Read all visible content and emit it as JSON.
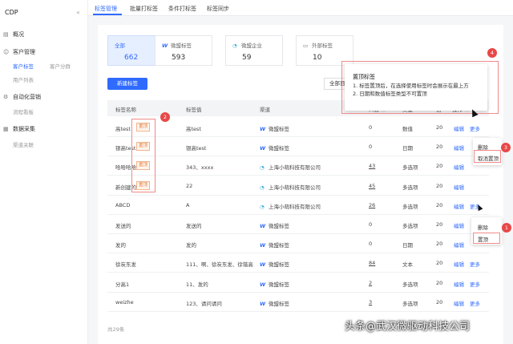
{
  "app": {
    "name": "CDP",
    "collapse_icon": "«"
  },
  "sidebar": {
    "overview": "概况",
    "customer_mgmt": "客户管理",
    "customer_tags": "客户标签",
    "customer_segment": "客户分群",
    "user_list": "用户列表",
    "automation": "自动化营销",
    "flow_board": "流程看板",
    "data_collect": "数据采集",
    "channel_link": "渠道关联"
  },
  "tabs": [
    "标签管理",
    "批量打标签",
    "条件打标签",
    "标签同步"
  ],
  "cards": [
    {
      "title": "全部",
      "value": "662"
    },
    {
      "title": "微盟标签",
      "value": "593"
    },
    {
      "title": "微盟企业",
      "value": "59"
    },
    {
      "title": "外部标签",
      "value": "10"
    }
  ],
  "buttons": {
    "new_tag": "新建标签",
    "all_filter": "全部目标"
  },
  "table": {
    "headers": [
      "标签名称",
      "标签值",
      "渠道",
      "人数",
      "类型",
      "创",
      "操作"
    ],
    "rows": [
      {
        "name": "高test",
        "pinned": true,
        "value": "高test",
        "channel": "微盟标签",
        "ch": "w",
        "count": "0",
        "count_u": false,
        "type": "数值",
        "date": "20",
        "more": true
      },
      {
        "name": "银高test",
        "pinned": true,
        "value": "银高test",
        "channel": "微盟标签",
        "ch": "w",
        "count": "0",
        "count_u": false,
        "type": "日期",
        "date": "20",
        "more": false
      },
      {
        "name": "哈哈哈哈",
        "pinned": true,
        "value": "343、xxxx",
        "channel": "上海小萌科技有限公司",
        "ch": "q",
        "count": "43",
        "count_u": true,
        "type": "多选项",
        "date": "20",
        "more": false
      },
      {
        "name": "新创建的",
        "pinned": true,
        "value": "22",
        "channel": "上海小萌科技有限公司",
        "ch": "q",
        "count": "45",
        "count_u": true,
        "type": "多选项",
        "date": "20",
        "more": false
      },
      {
        "name": "ABCD",
        "pinned": false,
        "value": "A",
        "channel": "上海小萌科技有限公司",
        "ch": "q",
        "count": "26",
        "count_u": true,
        "type": "多选项",
        "date": "20",
        "more": true
      },
      {
        "name": "发送的",
        "pinned": false,
        "value": "发送的",
        "channel": "微盟标签",
        "ch": "w",
        "count": "0",
        "count_u": false,
        "type": "多选项",
        "date": "20",
        "more": false
      },
      {
        "name": "发的",
        "pinned": false,
        "value": "发的",
        "channel": "微盟标签",
        "ch": "w",
        "count": "0",
        "count_u": false,
        "type": "日期",
        "date": "20",
        "more": false
      },
      {
        "name": "徐炭东发",
        "pinned": false,
        "value": "111、啊、徐炭东发、徐锴高",
        "channel": "微盟标签",
        "ch": "w",
        "count": "84",
        "count_u": true,
        "type": "文本",
        "date": "20",
        "more": true
      },
      {
        "name": "分高1",
        "pinned": false,
        "value": "11、发的",
        "channel": "微盟标签",
        "ch": "w",
        "count": "2",
        "count_u": true,
        "type": "多选项",
        "date": "20",
        "more": true
      },
      {
        "name": "weizhe",
        "pinned": false,
        "value": "123、请问请问",
        "channel": "微盟标签",
        "ch": "w",
        "count": "3",
        "count_u": true,
        "type": "多选项",
        "date": "20",
        "more": true
      }
    ],
    "pin_label": "置顶",
    "edit": "编辑",
    "more": "更多",
    "total": "共29条"
  },
  "tooltip": {
    "title": "置顶标签",
    "line1": "1. 标签置顶后，在选择使用标签时会展示在最上方",
    "line2": "2. 日期和数值标签类型不可置顶"
  },
  "menu_top": {
    "item1": "删除",
    "item2": "取消置顶"
  },
  "menu_bottom": {
    "item1": "删除",
    "item2": "置顶"
  },
  "markers": [
    "1",
    "2",
    "3",
    "4"
  ],
  "watermark": "头条@武汉微驱动科技公司",
  "colors": {
    "primary": "#2f6bff",
    "marker": "#e84848",
    "pin": "#e07b39"
  }
}
